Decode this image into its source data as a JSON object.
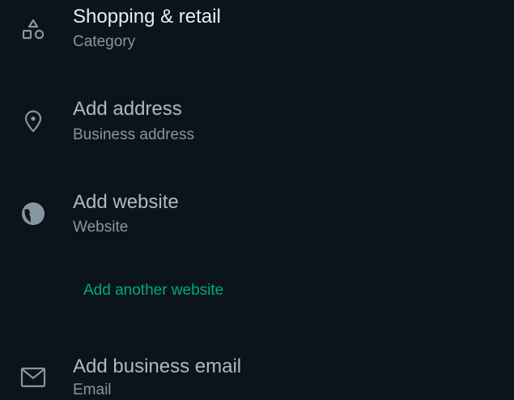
{
  "colors": {
    "background": "#0b141a",
    "primary_text": "#e9edef",
    "secondary_text": "#8696a0",
    "placeholder_text": "#aebac1",
    "icon": "#8696a0",
    "accent": "#00a884"
  },
  "rows": [
    {
      "icon": "shapes-icon",
      "title": "Shopping & retail",
      "subtitle": "Category"
    },
    {
      "icon": "location-pin-icon",
      "title": "Add address",
      "subtitle": "Business address"
    },
    {
      "icon": "globe-icon",
      "title": "Add website",
      "subtitle": "Website"
    },
    {
      "icon": "mail-icon",
      "title": "Add business email",
      "subtitle": "Email"
    }
  ],
  "add_another_website": "Add another website"
}
